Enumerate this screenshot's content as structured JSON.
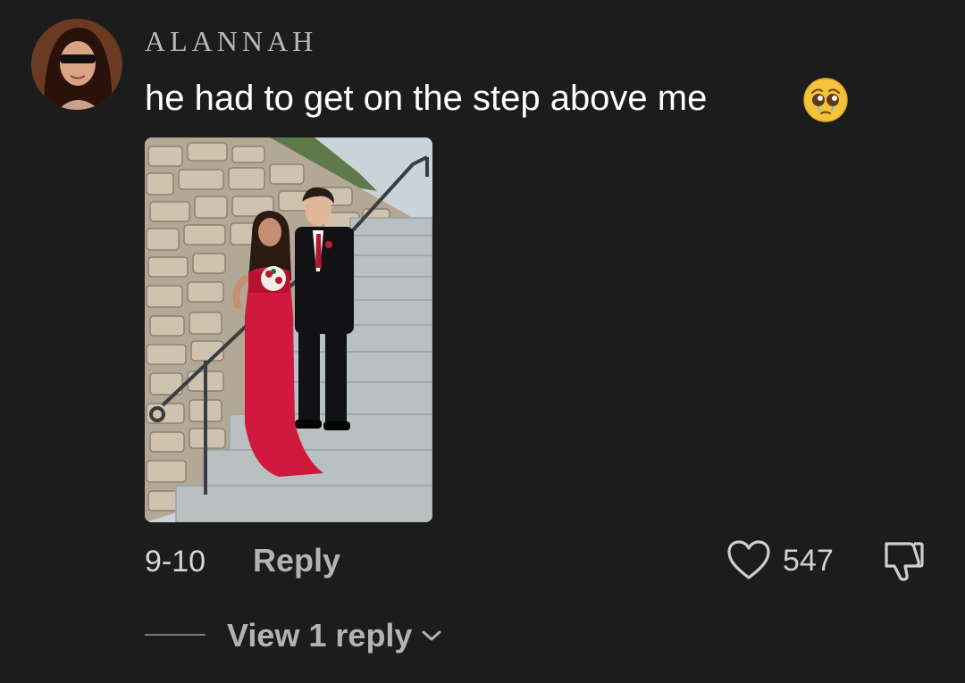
{
  "comment": {
    "username": "ALANNAH",
    "text": "he had to get on the step above me",
    "emoji": "pleading-face-emoji",
    "date": "9-10",
    "reply_label": "Reply",
    "like_count": "547"
  },
  "replies": {
    "view_label": "View 1 reply"
  },
  "icons": {
    "avatar": "avatar",
    "like": "heart-icon",
    "dislike": "thumbs-down-icon",
    "expand": "chevron-down-icon"
  },
  "colors": {
    "background": "#1c1c1c",
    "username": "#b9b9b9",
    "comment_text": "#ffffff",
    "secondary_text": "#b3b3b3"
  }
}
